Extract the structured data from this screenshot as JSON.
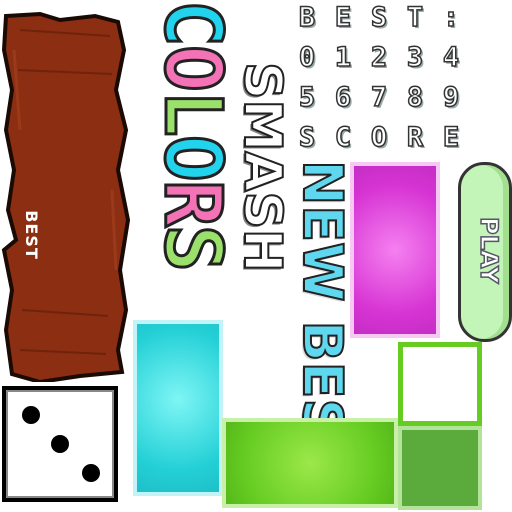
{
  "plank": {
    "label": "BEST"
  },
  "titles": {
    "colors_letters": [
      "C",
      "O",
      "L",
      "O",
      "R",
      "S"
    ],
    "smash": "SMASH",
    "new_best": "NEW BEST!"
  },
  "font_sheet": {
    "row1": [
      "B",
      "E",
      "S",
      "T",
      ":"
    ],
    "row2": [
      "0",
      "1",
      "2",
      "3",
      "4"
    ],
    "row3": [
      "5",
      "6",
      "7",
      "8",
      "9"
    ],
    "row4": [
      "S",
      "C",
      "O",
      "R",
      "E"
    ]
  },
  "play_button": {
    "label": "PLAY"
  },
  "dice": {
    "face_value": 3,
    "icon": "dice-three-icon"
  },
  "colors": {
    "wood": "#8b2e12",
    "magenta": "#d633d3",
    "cyan": "#23d0d6",
    "green": "#66cc22",
    "dark_green": "#5aab3c",
    "play_green": "#c4f5b8"
  }
}
